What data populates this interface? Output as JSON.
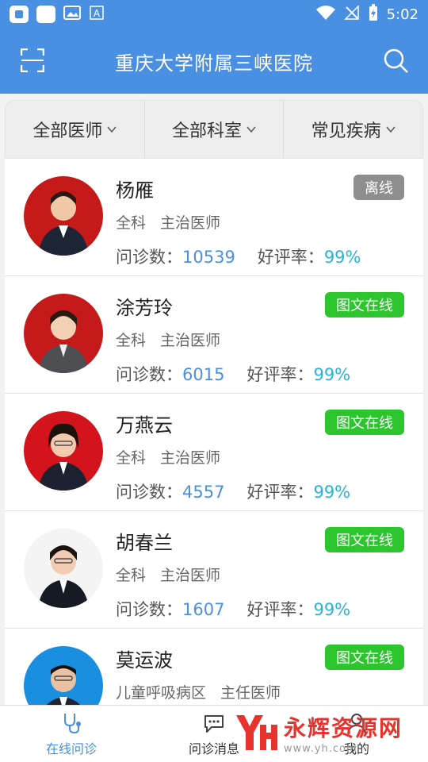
{
  "status_bar": {
    "time": "5:02",
    "icons": [
      "notification-icon",
      "app-icon",
      "image-icon",
      "a-icon",
      "wifi-icon",
      "no-signal-icon",
      "battery-icon"
    ]
  },
  "header": {
    "title": "重庆大学附属三峡医院"
  },
  "filters": [
    {
      "label": "全部医师"
    },
    {
      "label": "全部科室"
    },
    {
      "label": "常见疾病"
    }
  ],
  "doctors": [
    {
      "name": "杨雁",
      "status": "离线",
      "status_type": "offline",
      "dept": "全科",
      "title": "主治医师",
      "consult_label": "问诊数：",
      "consults": "10539",
      "rate_label": "好评率：",
      "rate": "99%"
    },
    {
      "name": "涂芳玲",
      "status": "图文在线",
      "status_type": "online",
      "dept": "全科",
      "title": "主治医师",
      "consult_label": "问诊数：",
      "consults": "6015",
      "rate_label": "好评率：",
      "rate": "99%"
    },
    {
      "name": "万燕云",
      "status": "图文在线",
      "status_type": "online",
      "dept": "全科",
      "title": "主治医师",
      "consult_label": "问诊数：",
      "consults": "4557",
      "rate_label": "好评率：",
      "rate": "99%"
    },
    {
      "name": "胡春兰",
      "status": "图文在线",
      "status_type": "online",
      "dept": "全科",
      "title": "主治医师",
      "consult_label": "问诊数：",
      "consults": "1607",
      "rate_label": "好评率：",
      "rate": "99%"
    },
    {
      "name": "莫运波",
      "status": "图文在线",
      "status_type": "online",
      "dept": "儿童呼吸病区",
      "title": "主任医师"
    }
  ],
  "tabs": [
    {
      "label": "在线问诊",
      "active": true
    },
    {
      "label": "问诊消息",
      "active": false
    },
    {
      "label": "我的",
      "active": false
    }
  ],
  "watermark": {
    "title": "永辉资源网",
    "url": "www.yh.com"
  },
  "colors": {
    "primary": "#4a90e2",
    "online": "#2dc52d",
    "offline": "#8e8e8e",
    "rate": "#2bb3d6"
  }
}
